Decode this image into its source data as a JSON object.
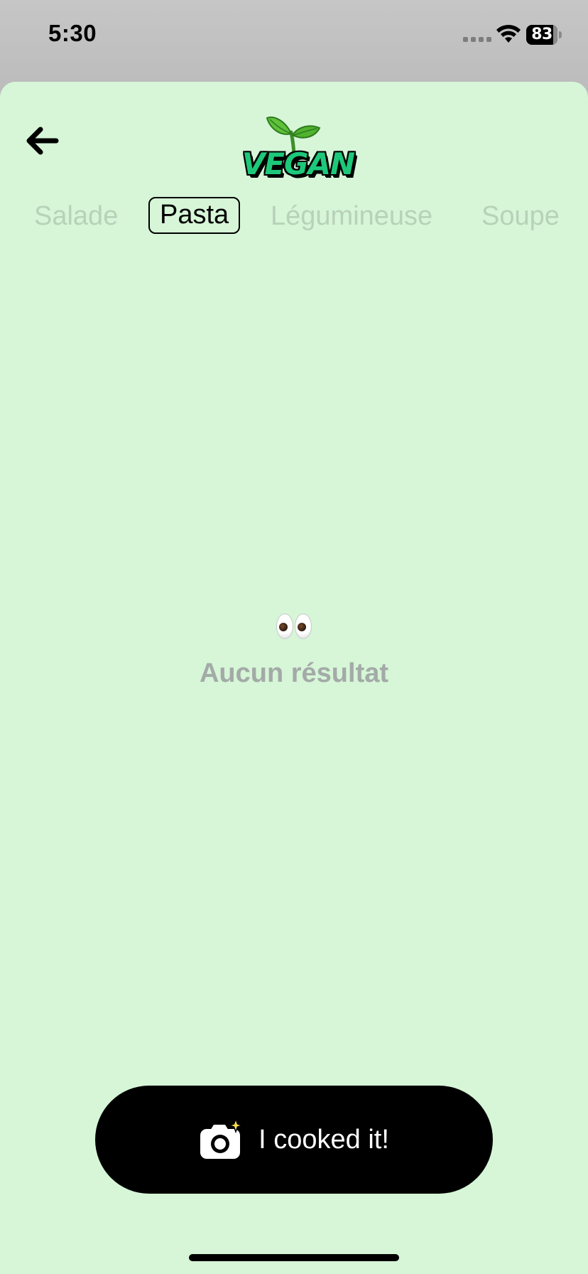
{
  "status_bar": {
    "time": "5:30",
    "battery_level": "83",
    "icons": [
      "signal-icon",
      "wifi-icon",
      "battery-icon"
    ]
  },
  "header": {
    "back_icon": "back-arrow-icon",
    "logo_text": "VEGAN",
    "logo_icon": "sprout-icon"
  },
  "tabs": [
    {
      "label": "Salade",
      "active": false
    },
    {
      "label": "Pasta",
      "active": true
    },
    {
      "label": "Légumineuse",
      "active": false
    },
    {
      "label": "Soupe",
      "active": false
    }
  ],
  "empty_state": {
    "icon": "eyes-icon",
    "text": "Aucun résultat"
  },
  "action": {
    "icon": "camera-sparkle-icon",
    "label": "I cooked it!"
  },
  "colors": {
    "background": "#d6f6d7",
    "tab_inactive": "#b8d1b9",
    "tab_active": "#000000",
    "button": "#000000",
    "logo_green": "#1dc87a",
    "empty_text": "#a3aaa7"
  }
}
